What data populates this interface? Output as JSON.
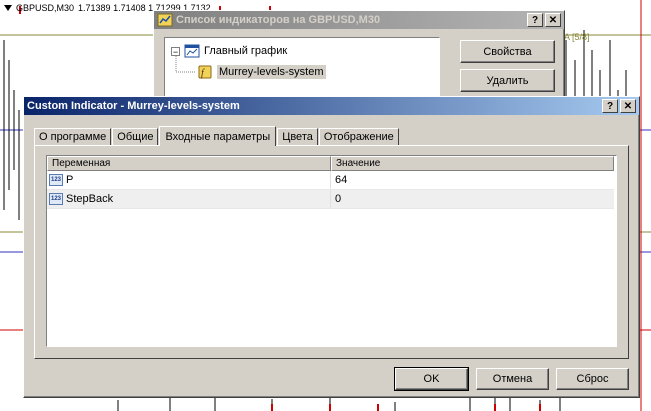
{
  "chart": {
    "symbol_line": "GBPUSD,M30",
    "ohlc": "1.71389 1.71408 1.71299 1.7132",
    "level_tag": "A [5/8]",
    "colors": {
      "olive": "#8a8a3a",
      "red": "#d00000",
      "blue": "#3030c0",
      "candle": "#000000"
    }
  },
  "list_window": {
    "title": "Список индикаторов на GBPUSD,M30",
    "title_buttons": [
      "?",
      "✕"
    ],
    "tree": {
      "root_label": "Главный график",
      "expander": "−",
      "child_label": "Murrey-levels-system",
      "root_icon": "chart-window-icon",
      "child_icon": "custom-indicator-icon"
    },
    "buttons": {
      "properties": "Свойства",
      "delete": "Удалить"
    }
  },
  "dialog": {
    "title": "Custom Indicator - Murrey-levels-system",
    "title_buttons": [
      "?",
      "✕"
    ],
    "tabs": [
      "О программе",
      "Общие",
      "Входные параметры",
      "Цвета",
      "Отображение"
    ],
    "active_tab": "Входные параметры",
    "table": {
      "headers": [
        "Переменная",
        "Значение"
      ],
      "rows": [
        {
          "name": "P",
          "value": "64",
          "icon": "integer-param-icon"
        },
        {
          "name": "StepBack",
          "value": "0",
          "icon": "integer-param-icon"
        }
      ],
      "icon_text": "123"
    },
    "buttons": {
      "ok": "OK",
      "cancel": "Отмена",
      "reset": "Сброс"
    }
  }
}
